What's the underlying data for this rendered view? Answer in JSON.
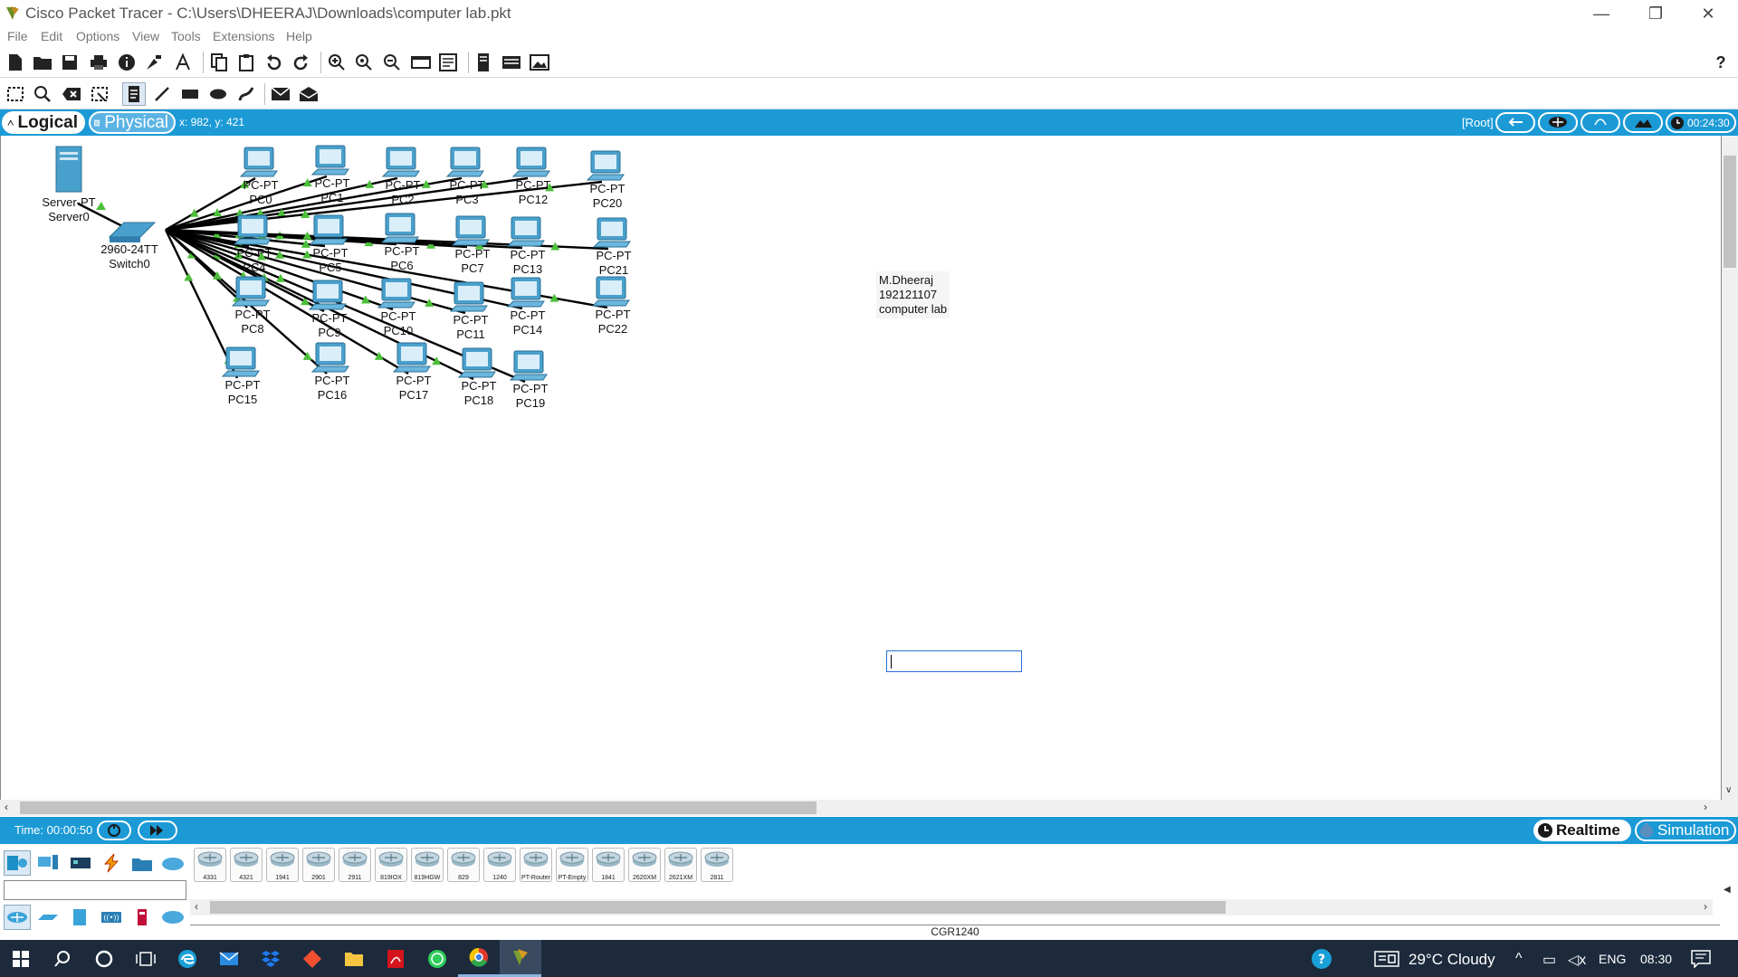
{
  "window": {
    "title": "Cisco Packet Tracer - C:\\Users\\DHEERAJ\\Downloads\\computer lab.pkt",
    "minimize_glyph": "—",
    "maximize_glyph": "❐",
    "close_glyph": "✕"
  },
  "menu": [
    "File",
    "Edit",
    "Options",
    "View",
    "Tools",
    "Extensions",
    "Help"
  ],
  "main_toolbar": {
    "icons": [
      "new-file-icon",
      "open-folder-icon",
      "save-icon",
      "print-icon",
      "info-icon",
      "activity-wizard-icon",
      "font-icon",
      "copy-icon",
      "paste-icon",
      "undo-icon",
      "redo-icon",
      "zoom-in-icon",
      "zoom-reset-icon",
      "zoom-out-icon",
      "drawing-palette-icon",
      "custom-device-icon",
      "cluster-icon",
      "network-info-icon",
      "screenshot-icon"
    ],
    "help": "?"
  },
  "tools_toolbar": {
    "icons": [
      "select-icon",
      "inspect-icon",
      "delete-icon",
      "resize-icon",
      "place-note-icon",
      "draw-line-icon",
      "draw-rectangle-icon",
      "draw-ellipse-icon",
      "freeform-icon",
      "simple-pdu-icon",
      "complex-pdu-icon"
    ]
  },
  "modebar": {
    "logical": "Logical",
    "physical": "Physical",
    "coords": "x: 982, y: 421",
    "root": "[Root]",
    "clock": "00:24:30"
  },
  "topology": {
    "server": {
      "type": "Server-PT",
      "name": "Server0"
    },
    "switch": {
      "type": "2960-24TT",
      "name": "Switch0"
    },
    "pcs": [
      {
        "type": "PC-PT",
        "name": "PC0"
      },
      {
        "type": "PC-PT",
        "name": "PC1"
      },
      {
        "type": "PC-PT",
        "name": "PC2"
      },
      {
        "type": "PC-PT",
        "name": "PC3"
      },
      {
        "type": "PC-PT",
        "name": "PC12"
      },
      {
        "type": "PC-PT",
        "name": "PC20"
      },
      {
        "type": "PC-PT",
        "name": "PC4"
      },
      {
        "type": "PC-PT",
        "name": "PC5"
      },
      {
        "type": "PC-PT",
        "name": "PC6"
      },
      {
        "type": "PC-PT",
        "name": "PC7"
      },
      {
        "type": "PC-PT",
        "name": "PC13"
      },
      {
        "type": "PC-PT",
        "name": "PC21"
      },
      {
        "type": "PC-PT",
        "name": "PC8"
      },
      {
        "type": "PC-PT",
        "name": "PC9"
      },
      {
        "type": "PC-PT",
        "name": "PC10"
      },
      {
        "type": "PC-PT",
        "name": "PC11"
      },
      {
        "type": "PC-PT",
        "name": "PC14"
      },
      {
        "type": "PC-PT",
        "name": "PC22"
      },
      {
        "type": "PC-PT",
        "name": "PC15"
      },
      {
        "type": "PC-PT",
        "name": "PC16"
      },
      {
        "type": "PC-PT",
        "name": "PC17"
      },
      {
        "type": "PC-PT",
        "name": "PC18"
      },
      {
        "type": "PC-PT",
        "name": "PC19"
      }
    ],
    "note": {
      "line1": "M.Dheeraj",
      "line2": "192121107",
      "line3": "computer lab"
    },
    "textbox_value": ""
  },
  "timebar": {
    "time": "Time: 00:00:50",
    "realtime": "Realtime",
    "simulation": "Simulation"
  },
  "device_panel": {
    "categories_top": [
      "network-devices-icon",
      "end-devices-icon",
      "components-icon",
      "connections-icon",
      "miscellaneous-icon",
      "multiuser-icon"
    ],
    "categories_bottom": [
      "routers-icon",
      "switches-icon",
      "hubs-icon",
      "wireless-icon",
      "security-icon",
      "wan-emulation-icon"
    ],
    "search_value": "",
    "devices": [
      "4331",
      "4321",
      "1941",
      "2901",
      "2911",
      "819IOX",
      "819HGW",
      "829",
      "1240",
      "PT-Router",
      "PT-Empty",
      "1841",
      "2620XM",
      "2621XM",
      "2811"
    ],
    "selected_name": "CGR1240"
  },
  "taskbar": {
    "apps": [
      "windows-start-icon",
      "search-icon",
      "cortana-icon",
      "task-view-icon",
      "edge-icon",
      "mail-icon",
      "dropbox-icon",
      "git-icon",
      "file-explorer-icon",
      "acrobat-icon",
      "whatsapp-icon",
      "chrome-icon",
      "packet-tracer-icon"
    ],
    "weather": "29°C  Cloudy",
    "lang": "ENG",
    "time": "08:30"
  }
}
